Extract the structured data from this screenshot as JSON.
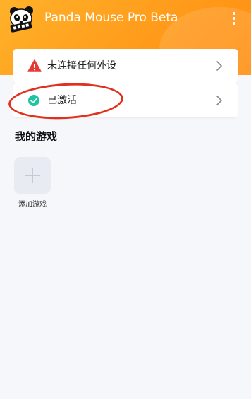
{
  "header": {
    "title": "Panda Mouse Pro Beta",
    "logo_icon": "panda-logo-icon",
    "menu_icon": "more-vertical-icon",
    "gradient_colors": [
      "#ffb12a",
      "#ff8d10"
    ]
  },
  "status_cards": [
    {
      "label": "未连接任何外设",
      "icon": "warning-triangle-icon",
      "icon_color": "#e53935"
    },
    {
      "label": "已激活",
      "icon": "check-circle-icon",
      "icon_color": "#1ec6a0",
      "highlighted": true,
      "highlight_color": "#e0301e"
    }
  ],
  "games_section": {
    "title": "我的游戏",
    "add_label": "添加游戏",
    "add_icon": "plus-icon"
  }
}
